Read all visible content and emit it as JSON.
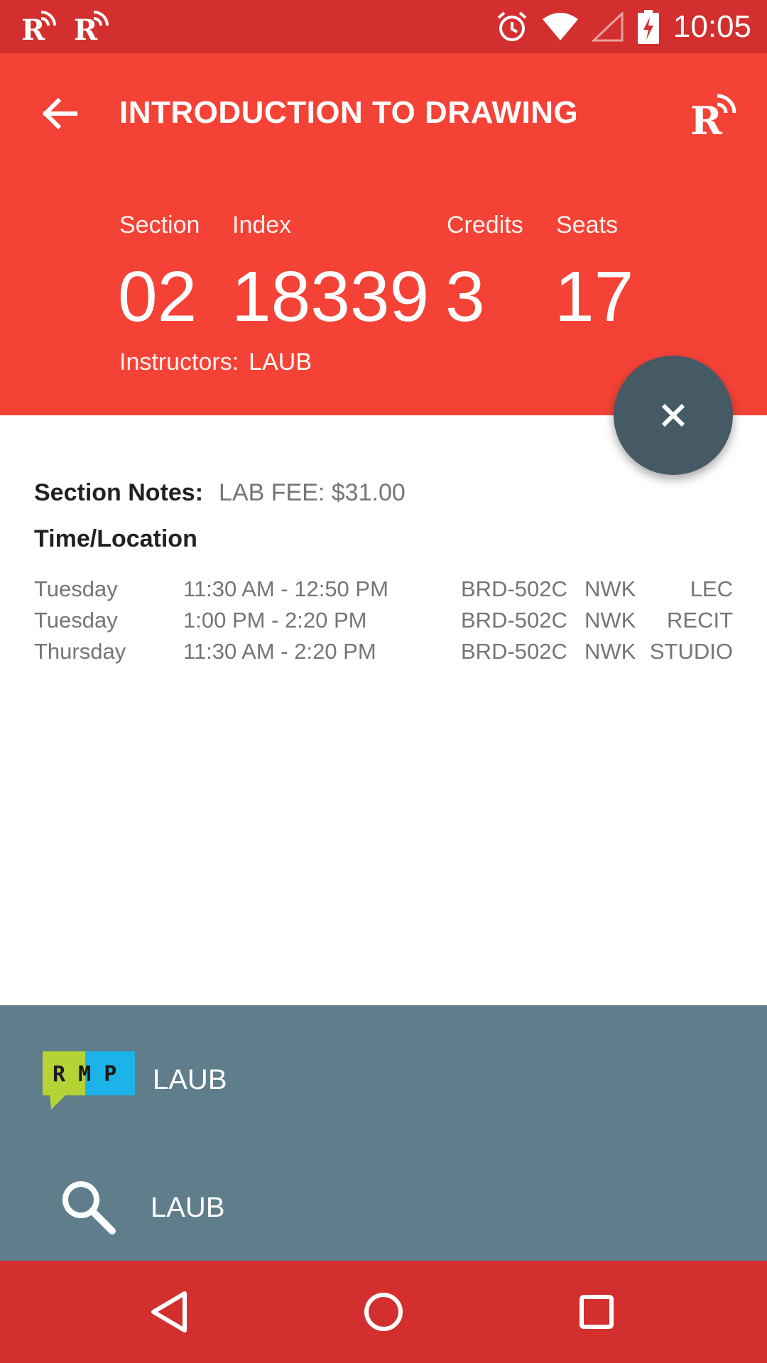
{
  "status_bar": {
    "time": "10:05",
    "notification_icons": [
      "rutgers-app-icon",
      "rutgers-app-icon"
    ],
    "system_icons": [
      "alarm-icon",
      "wifi-icon",
      "cell-signal-icon",
      "battery-charging-icon"
    ]
  },
  "app_bar": {
    "title": "INTRODUCTION TO DRAWING",
    "back_icon": "arrow-back-icon",
    "action_icon": "rutgers-logo-icon"
  },
  "stats": {
    "section_label": "Section",
    "section_value": "02",
    "index_label": "Index",
    "index_value": "18339",
    "credits_label": "Credits",
    "credits_value": "3",
    "seats_label": "Seats",
    "seats_value": "17"
  },
  "instructors": {
    "label": "Instructors:",
    "value": "LAUB"
  },
  "fab": {
    "icon": "close-icon"
  },
  "section_notes": {
    "label": "Section Notes:",
    "value": "LAB FEE: $31.00"
  },
  "time_location": {
    "heading": "Time/Location",
    "rows": [
      {
        "day": "Tuesday",
        "time": "11:30 AM - 12:50 PM",
        "room": "BRD-502C",
        "campus": "NWK",
        "type": "LEC"
      },
      {
        "day": "Tuesday",
        "time": "1:00 PM - 2:20 PM",
        "room": "BRD-502C",
        "campus": "NWK",
        "type": "RECIT"
      },
      {
        "day": "Thursday",
        "time": "11:30 AM - 2:20 PM",
        "room": "BRD-502C",
        "campus": "NWK",
        "type": "STUDIO"
      }
    ]
  },
  "bottom_sheet": {
    "items": [
      {
        "icon": "rmp-logo",
        "logo_text": "R M P",
        "label": "LAUB"
      },
      {
        "icon": "search-icon",
        "label": "LAUB"
      }
    ]
  },
  "nav_bar": {
    "icons": [
      "nav-back-icon",
      "nav-home-icon",
      "nav-recents-icon"
    ]
  },
  "colors": {
    "status_bar": "#D32F2F",
    "app_bar": "#F44336",
    "fab": "#455A64",
    "bottom_sheet": "#607D8B",
    "nav_bar": "#D32F2F"
  }
}
